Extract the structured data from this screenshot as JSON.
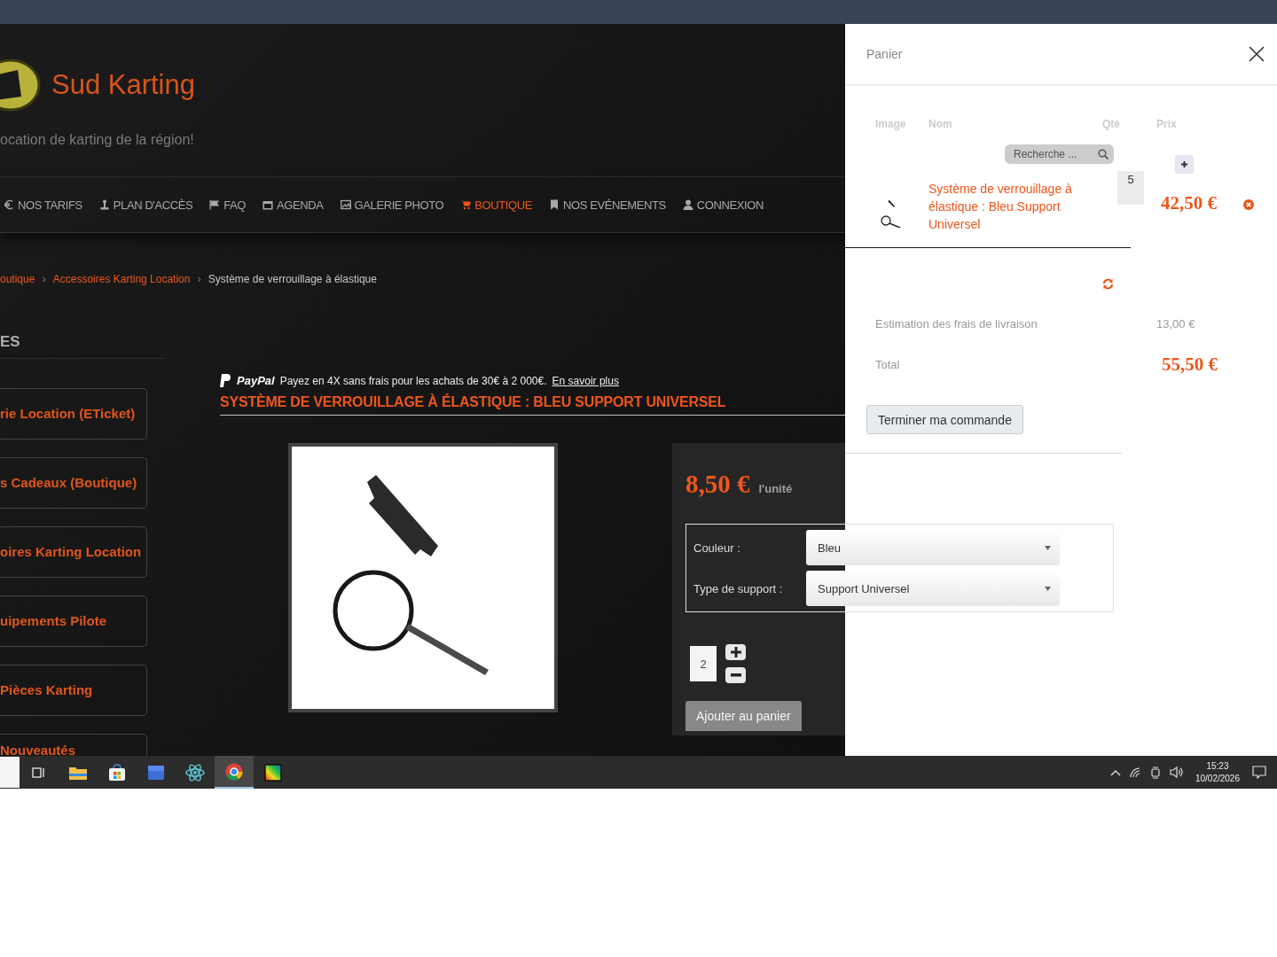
{
  "site": {
    "title": "Sud Karting",
    "tagline": "ocation de karting de la région!"
  },
  "nav": [
    {
      "label": "NOS TARIFS",
      "selected": false
    },
    {
      "label": "PLAN D'ACCÈS",
      "selected": false
    },
    {
      "label": "FAQ",
      "selected": false
    },
    {
      "label": "AGENDA",
      "selected": false
    },
    {
      "label": "GALERIE PHOTO",
      "selected": false
    },
    {
      "label": "BOUTIQUE",
      "selected": true
    },
    {
      "label": "NOS EVÉNEMENTS",
      "selected": false
    },
    {
      "label": "CONNEXION",
      "selected": false
    }
  ],
  "breadcrumb": [
    {
      "label": "outique",
      "kind": "link"
    },
    {
      "separator": "›",
      "label": "Accessoires Karting Location",
      "kind": "link"
    },
    {
      "separator": "›",
      "label": "Système de verrouillage à élastique",
      "kind": "current"
    }
  ],
  "sidebar": {
    "heading": "ES",
    "items": [
      "rie Location (ETicket)",
      "s Cadeaux (Boutique)",
      "oires Karting Location",
      "uipements Pilote",
      "Pièces Karting",
      "Nouveautés"
    ]
  },
  "paypal": {
    "brand": "PayPal",
    "message": "Payez en 4X sans frais pour les achats de 30€ à 2 000€.",
    "link": "En savoir plus"
  },
  "product": {
    "title": "SYSTÈME DE VERROUILLAGE À ÉLASTIQUE : BLEU SUPPORT UNIVERSEL",
    "price": "8,50 €",
    "unit": "l'unité",
    "options": [
      {
        "label": "Couleur :",
        "value": "Bleu"
      },
      {
        "label": "Type de support :",
        "value": "Support Universel"
      }
    ],
    "quantity": "2",
    "add_button": "Ajouter au panier"
  },
  "cart": {
    "title": "Panier",
    "columns": [
      "Image",
      "Nom",
      "Qté",
      "Prix"
    ],
    "item": {
      "name": "Système de verrouillage à élastique : Bleu Support Universel",
      "quantity": "5",
      "price": "42,50 €"
    },
    "search_placeholder": "Recherche ...",
    "shipping": {
      "label": "Estimation des frais de livraison",
      "value": "13,00 €"
    },
    "total": {
      "label": "Total",
      "value": "55,50 €"
    },
    "checkout_button": "Terminer ma commande"
  },
  "taskbar": {
    "apps": [
      {
        "selected": false
      },
      {
        "selected": false
      },
      {
        "selected": false
      },
      {
        "selected": false
      },
      {
        "selected": false
      },
      {
        "selected": true
      },
      {
        "selected": false
      }
    ],
    "time": "15:23",
    "date": "10/02/2026"
  }
}
